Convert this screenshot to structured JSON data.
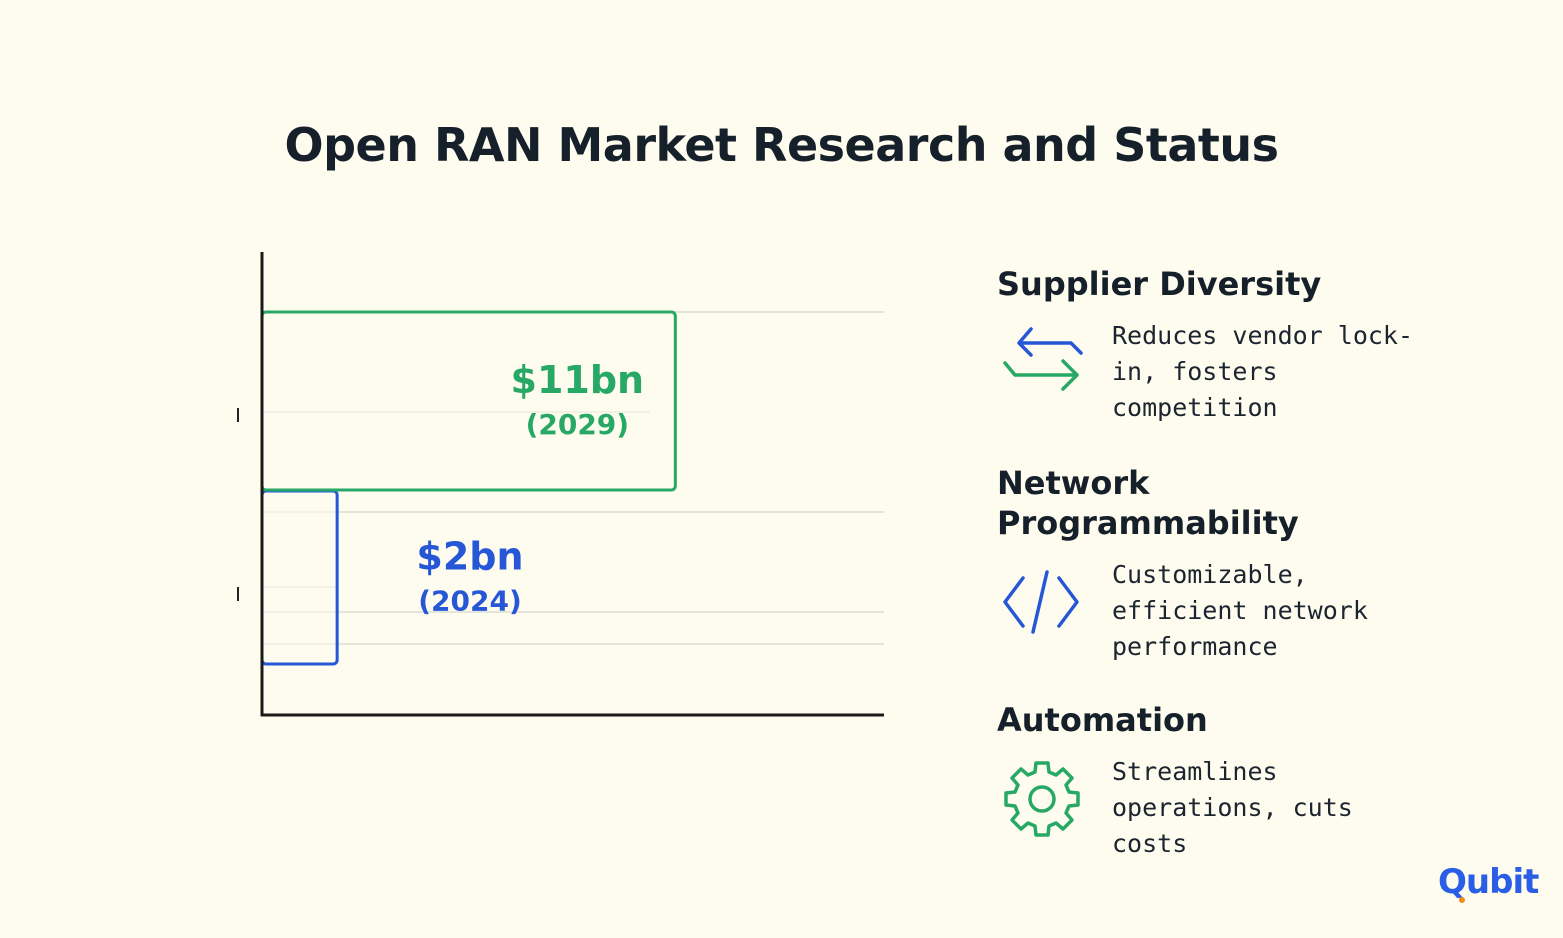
{
  "title": "Open RAN Market Research and Status",
  "chart_data": {
    "type": "bar",
    "orientation": "horizontal",
    "categories": [
      "2024",
      "2029"
    ],
    "values": [
      2,
      11
    ],
    "unit": "bn USD",
    "labels": [
      {
        "value": "$2bn",
        "year": "(2024)",
        "color": "#2557d6"
      },
      {
        "value": "$11bn",
        "year": "(2029)",
        "color": "#28a865"
      }
    ],
    "xlim": [
      0,
      16.5
    ],
    "grid": true,
    "title": "",
    "xlabel": "",
    "ylabel": ""
  },
  "features": [
    {
      "title": "Supplier Diversity",
      "icon": "swap-arrows-icon",
      "desc": "Reduces vendor lock-in, fosters competition"
    },
    {
      "title": "Network Programmability",
      "icon": "code-icon",
      "desc": "Customizable, efficient network performance"
    },
    {
      "title": "Automation",
      "icon": "gear-icon",
      "desc": "Streamlines operations, cuts costs"
    }
  ],
  "colors": {
    "background": "#fdfcee",
    "blue": "#2557d6",
    "green": "#28a865",
    "text": "#16202a",
    "logo": "#2a5ee6",
    "logo_accent": "#f28c1c"
  },
  "logo": {
    "text": "Qubit"
  }
}
